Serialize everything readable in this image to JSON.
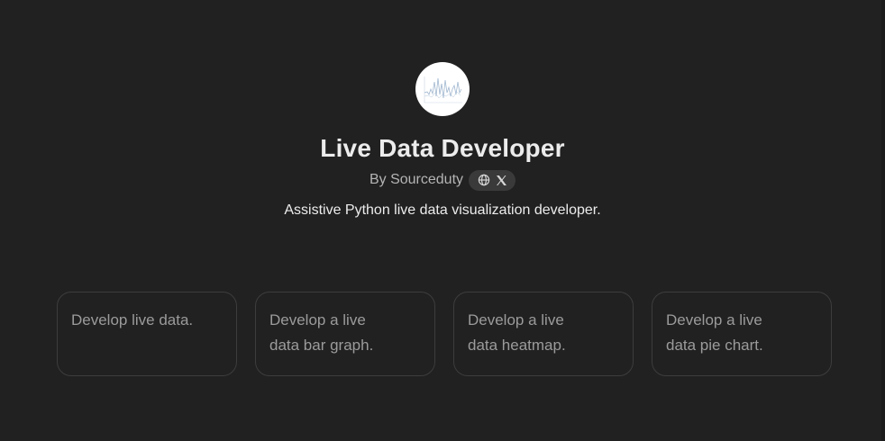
{
  "gpt": {
    "title": "Live Data Developer",
    "author": "By Sourceduty",
    "description": "Assistive Python live data visualization developer.",
    "avatar_icon": "line-chart-thumbnail",
    "social_links": [
      {
        "icon": "globe-icon"
      },
      {
        "icon": "x-logo-icon"
      }
    ]
  },
  "conversation_starters": [
    {
      "label": "Develop live data."
    },
    {
      "label": "Develop a live\ndata bar graph."
    },
    {
      "label": "Develop a live\ndata heatmap."
    },
    {
      "label": "Develop a live\ndata pie chart."
    }
  ],
  "colors": {
    "background": "#212121",
    "title": "#ececec",
    "muted": "#b4b4b4",
    "starter_text": "#9b9b9b",
    "starter_border": "#3d3d3d",
    "pill": "#3a3a3a"
  }
}
